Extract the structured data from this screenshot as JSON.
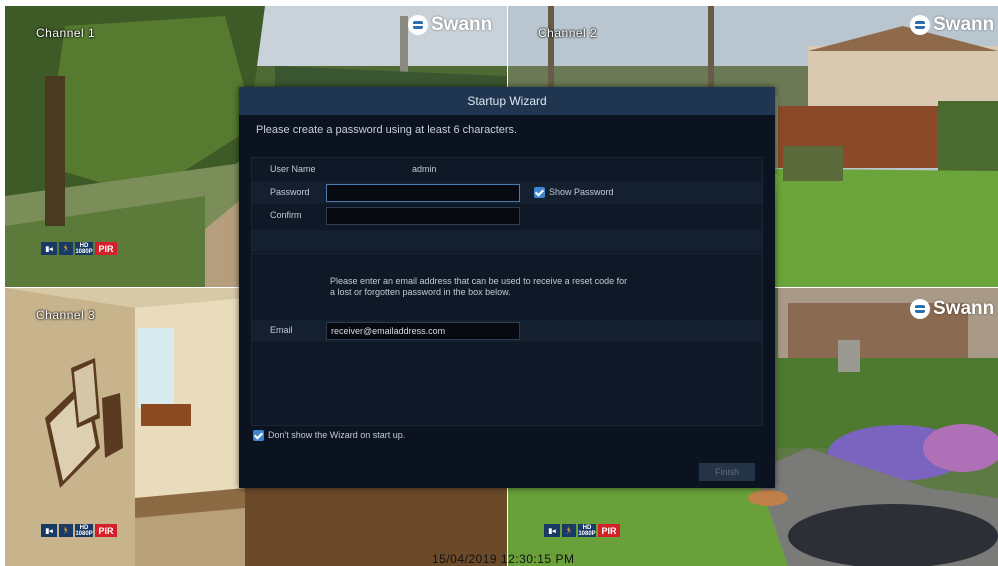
{
  "channels": [
    {
      "label": "Channel 1",
      "brand": "Swann",
      "show_brand": true,
      "show_status": true
    },
    {
      "label": "Channel 2",
      "brand": "Swann",
      "show_brand": true,
      "show_status": false
    },
    {
      "label": "Channel 3",
      "brand": "Swann",
      "show_brand": false,
      "show_status": true
    },
    {
      "label": "",
      "brand": "Swann",
      "show_brand": true,
      "show_status": true
    }
  ],
  "status_icons": {
    "camera": "camera-icon",
    "motion": "motion-person-icon",
    "hd": "HD\n1080P",
    "pir": "PIR"
  },
  "timestamp": "15/04/2019 12:30:15 PM",
  "wizard": {
    "title": "Startup Wizard",
    "intro": "Please create a password using at least 6 characters.",
    "user_name_label": "User Name",
    "user_name_value": "admin",
    "password_label": "Password",
    "password_value": "",
    "show_password_label": "Show Password",
    "show_password_checked": true,
    "confirm_label": "Confirm",
    "confirm_value": "",
    "email_note": "Please enter an email address that can be used to receive a reset code for a lost or forgotten password in the box below.",
    "email_label": "Email",
    "email_value": "receiver@emailaddress.com",
    "dont_show_label": "Don't show the Wizard on start up.",
    "dont_show_checked": true,
    "finish_label": "Finish"
  },
  "colors": {
    "accent": "#3f86d1",
    "pir": "#d4202a",
    "title_bar": "#1f3550",
    "dialog_bg": "#0b1320"
  }
}
